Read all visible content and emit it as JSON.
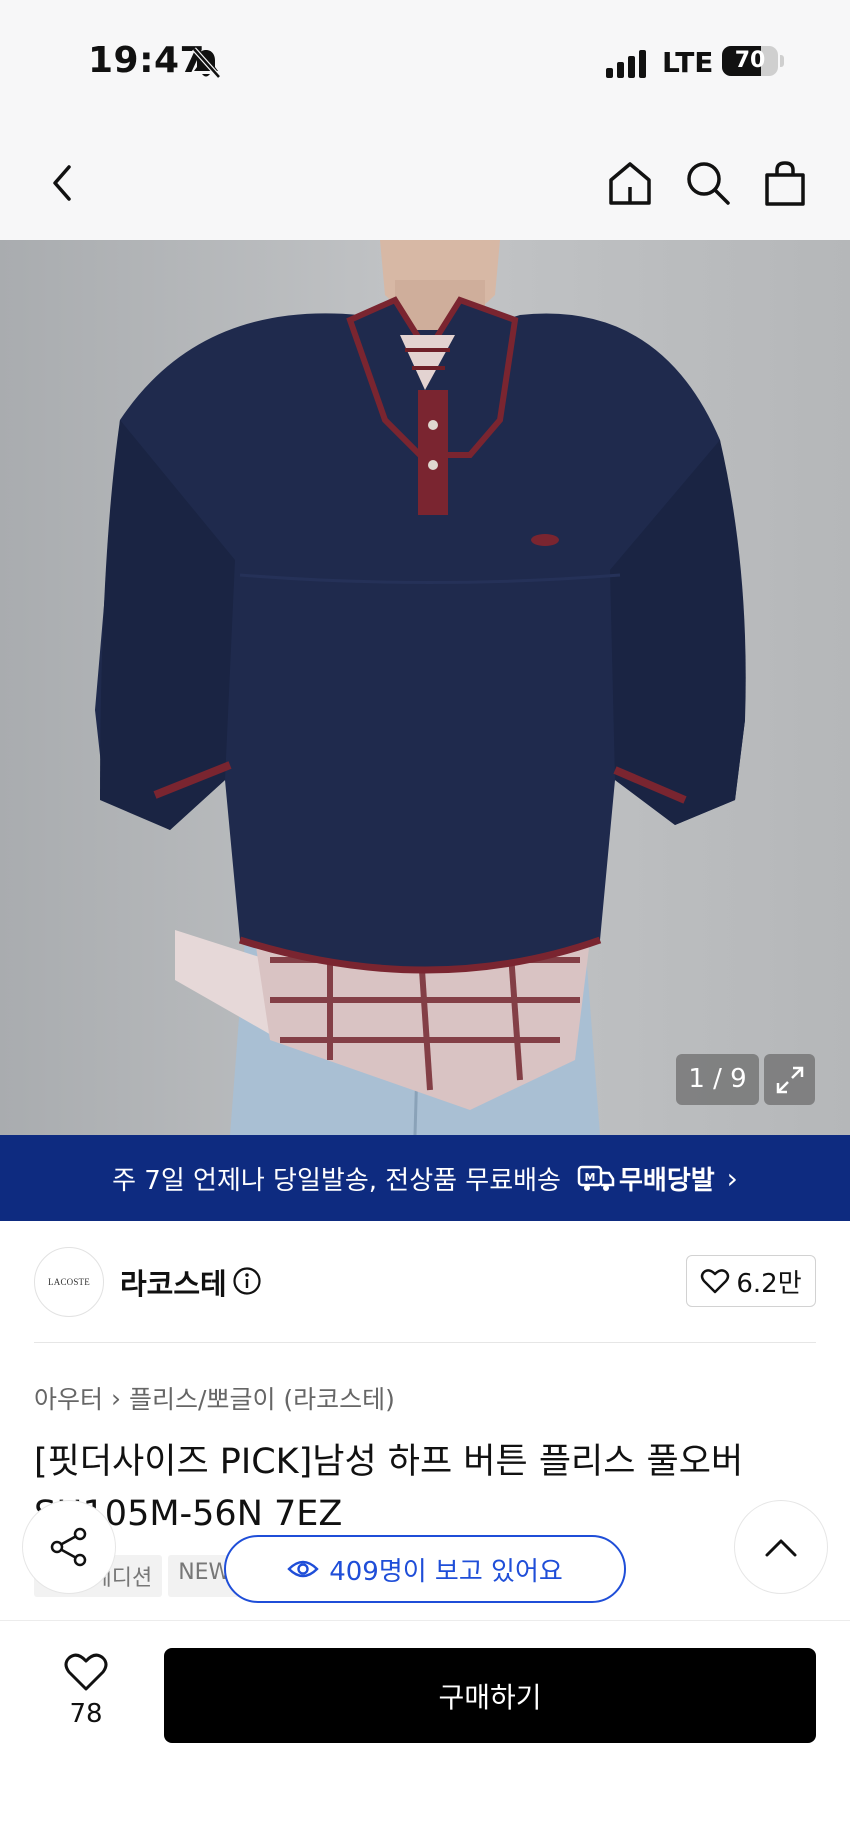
{
  "status_bar": {
    "time": "19:47",
    "network": "LTE",
    "battery": "70",
    "battery_level": 0.7
  },
  "nav": {
    "back_icon": "chevron-left-icon",
    "home_icon": "home-icon",
    "search_icon": "search-icon",
    "cart_icon": "shopping-bag-icon"
  },
  "gallery": {
    "counter": "1 / 9",
    "expand_icon": "expand-icon"
  },
  "banner": {
    "text": "주 7일 언제나 당일발송, 전상품 무료배송",
    "logo_text": "무배당발",
    "background": "#0e2b80"
  },
  "brand": {
    "logo_text": "LACOSTE",
    "name": "라코스테",
    "follow_count": "6.2만"
  },
  "breadcrumb": {
    "category": "아우터",
    "subcategory": "플리스/뽀글이 (라코스테)"
  },
  "product": {
    "title": "[핏더사이즈 PICK]남성 하프 버튼 플리스 풀오버 SH105M-56N 7EZ",
    "tags": [
      "루스 에디션",
      "NEW"
    ]
  },
  "floating": {
    "viewers_text": "409명이 보고 있어요",
    "accent": "#1f4ed8"
  },
  "bottom_bar": {
    "like_count": "78",
    "buy_label": "구매하기"
  }
}
